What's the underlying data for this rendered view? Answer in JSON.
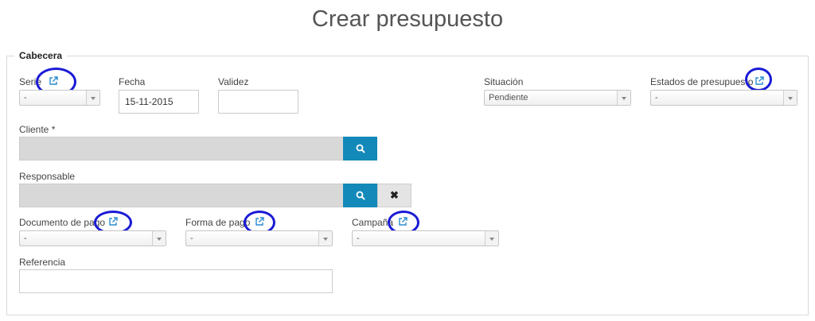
{
  "page_title": "Crear presupuesto",
  "section_title": "Cabecera",
  "fields": {
    "serie": {
      "label": "Serie",
      "value": "-"
    },
    "fecha": {
      "label": "Fecha",
      "value": "15-11-2015"
    },
    "validez": {
      "label": "Validez",
      "value": ""
    },
    "situacion": {
      "label": "Situación",
      "value": "Pendiente"
    },
    "estados": {
      "label": "Estados de presupuesto",
      "value": "-"
    },
    "cliente": {
      "label": "Cliente *",
      "value": ""
    },
    "responsable": {
      "label": "Responsable",
      "value": ""
    },
    "documento_pago": {
      "label": "Documento de pago",
      "value": "-"
    },
    "forma_pago": {
      "label": "Forma de pago",
      "value": "-"
    },
    "campana": {
      "label": "Campaña",
      "value": "-"
    },
    "referencia": {
      "label": "Referencia",
      "value": ""
    }
  },
  "buttons": {
    "clear_glyph": "✖"
  },
  "icons": [
    "external-link-icon",
    "search-icon",
    "close-icon"
  ],
  "colors": {
    "accent": "#1289b8",
    "annotation_circle": "#1a1ad6",
    "link_icon": "#2a8bd0"
  }
}
